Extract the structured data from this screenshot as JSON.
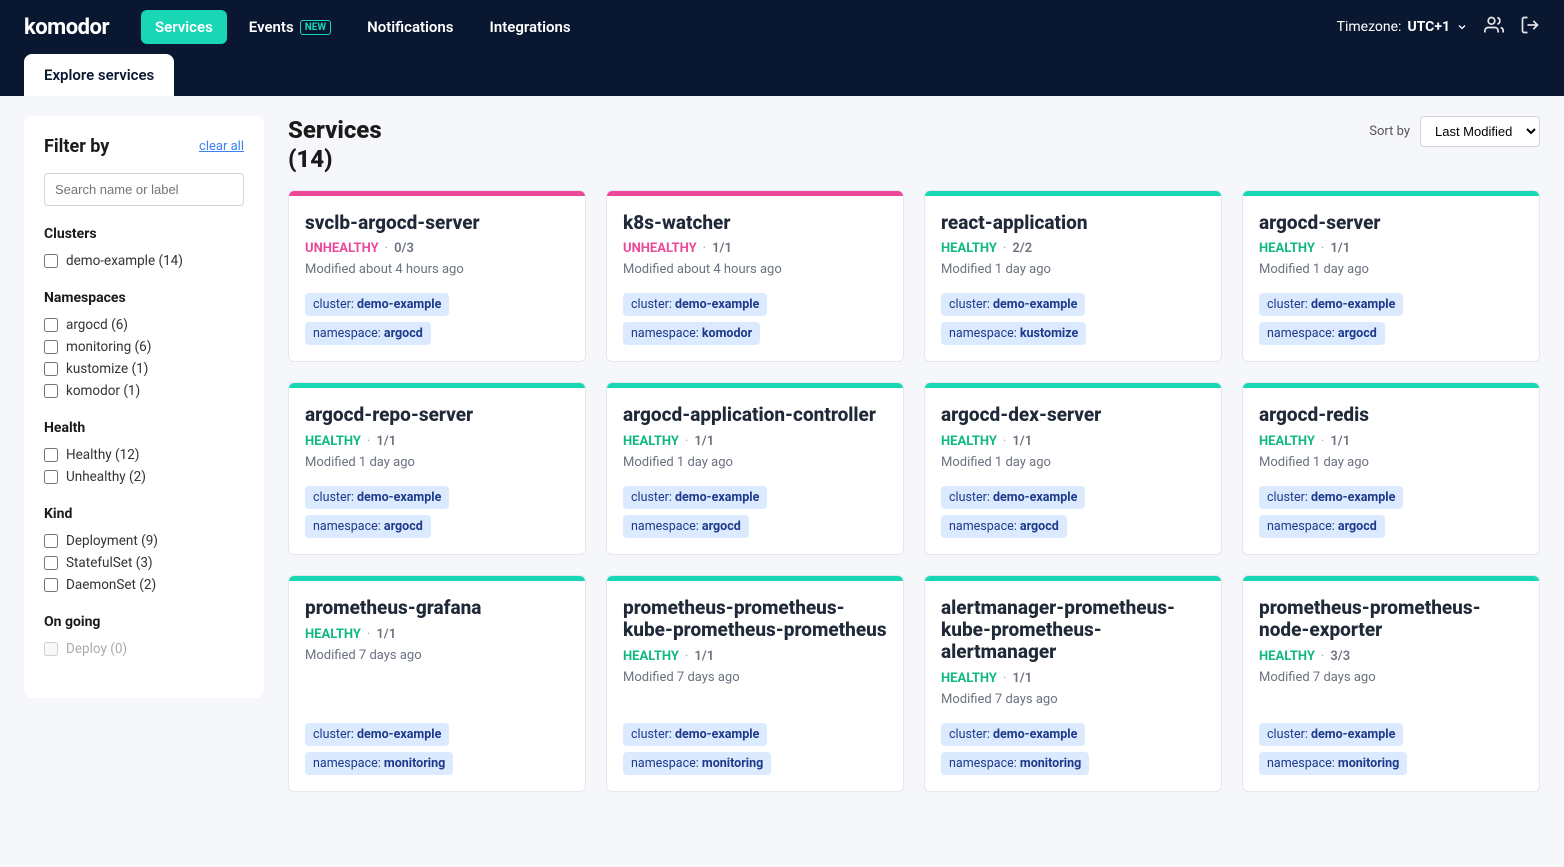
{
  "nav": {
    "logo": "komodor",
    "items": [
      {
        "label": "Services",
        "active": true,
        "badge": null
      },
      {
        "label": "Events",
        "active": false,
        "badge": "NEW"
      },
      {
        "label": "Notifications",
        "active": false,
        "badge": null
      },
      {
        "label": "Integrations",
        "active": false,
        "badge": null
      }
    ],
    "timezone_label": "Timezone:",
    "timezone_value": "UTC+1"
  },
  "tab": "Explore services",
  "sidebar": {
    "title": "Filter by",
    "clear": "clear all",
    "search_placeholder": "Search name or label",
    "groups": [
      {
        "title": "Clusters",
        "items": [
          {
            "label": "demo-example (14)",
            "disabled": false
          }
        ]
      },
      {
        "title": "Namespaces",
        "items": [
          {
            "label": "argocd (6)",
            "disabled": false
          },
          {
            "label": "monitoring (6)",
            "disabled": false
          },
          {
            "label": "kustomize (1)",
            "disabled": false
          },
          {
            "label": "komodor (1)",
            "disabled": false
          }
        ]
      },
      {
        "title": "Health",
        "items": [
          {
            "label": "Healthy (12)",
            "disabled": false
          },
          {
            "label": "Unhealthy (2)",
            "disabled": false
          }
        ]
      },
      {
        "title": "Kind",
        "items": [
          {
            "label": "Deployment (9)",
            "disabled": false
          },
          {
            "label": "StatefulSet (3)",
            "disabled": false
          },
          {
            "label": "DaemonSet (2)",
            "disabled": false
          }
        ]
      },
      {
        "title": "On going",
        "items": [
          {
            "label": "Deploy (0)",
            "disabled": true
          }
        ]
      }
    ]
  },
  "main": {
    "title": "Services",
    "count": "(14)",
    "sort_label": "Sort by",
    "sort_value": "Last Modified",
    "cards": [
      {
        "name": "svclb-argocd-server",
        "status": "UNHEALTHY",
        "health": "unhealthy",
        "replicas": "0/3",
        "modified": "Modified about 4 hours ago",
        "cluster": "demo-example",
        "namespace": "argocd"
      },
      {
        "name": "k8s-watcher",
        "status": "UNHEALTHY",
        "health": "unhealthy",
        "replicas": "1/1",
        "modified": "Modified about 4 hours ago",
        "cluster": "demo-example",
        "namespace": "komodor"
      },
      {
        "name": "react-application",
        "status": "HEALTHY",
        "health": "healthy",
        "replicas": "2/2",
        "modified": "Modified 1 day ago",
        "cluster": "demo-example",
        "namespace": "kustomize"
      },
      {
        "name": "argocd-server",
        "status": "HEALTHY",
        "health": "healthy",
        "replicas": "1/1",
        "modified": "Modified 1 day ago",
        "cluster": "demo-example",
        "namespace": "argocd"
      },
      {
        "name": "argocd-repo-server",
        "status": "HEALTHY",
        "health": "healthy",
        "replicas": "1/1",
        "modified": "Modified 1 day ago",
        "cluster": "demo-example",
        "namespace": "argocd"
      },
      {
        "name": "argocd-application-controller",
        "status": "HEALTHY",
        "health": "healthy",
        "replicas": "1/1",
        "modified": "Modified 1 day ago",
        "cluster": "demo-example",
        "namespace": "argocd"
      },
      {
        "name": "argocd-dex-server",
        "status": "HEALTHY",
        "health": "healthy",
        "replicas": "1/1",
        "modified": "Modified 1 day ago",
        "cluster": "demo-example",
        "namespace": "argocd"
      },
      {
        "name": "argocd-redis",
        "status": "HEALTHY",
        "health": "healthy",
        "replicas": "1/1",
        "modified": "Modified 1 day ago",
        "cluster": "demo-example",
        "namespace": "argocd"
      },
      {
        "name": "prometheus-grafana",
        "status": "HEALTHY",
        "health": "healthy",
        "replicas": "1/1",
        "modified": "Modified 7 days ago",
        "cluster": "demo-example",
        "namespace": "monitoring"
      },
      {
        "name": "prometheus-prometheus-kube-prometheus-prometheus",
        "status": "HEALTHY",
        "health": "healthy",
        "replicas": "1/1",
        "modified": "Modified 7 days ago",
        "cluster": "demo-example",
        "namespace": "monitoring"
      },
      {
        "name": "alertmanager-prometheus-kube-prometheus-alertmanager",
        "status": "HEALTHY",
        "health": "healthy",
        "replicas": "1/1",
        "modified": "Modified 7 days ago",
        "cluster": "demo-example",
        "namespace": "monitoring"
      },
      {
        "name": "prometheus-prometheus-node-exporter",
        "status": "HEALTHY",
        "health": "healthy",
        "replicas": "3/3",
        "modified": "Modified 7 days ago",
        "cluster": "demo-example",
        "namespace": "monitoring"
      }
    ]
  },
  "labels": {
    "cluster": "cluster:",
    "namespace": "namespace:"
  }
}
